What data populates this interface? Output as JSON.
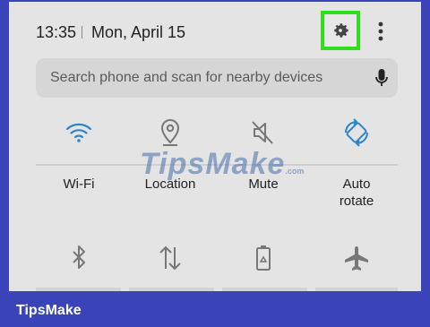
{
  "status": {
    "time": "13:35",
    "date": "Mon, April 15"
  },
  "search": {
    "placeholder": "Search phone and scan for nearby devices"
  },
  "tiles": [
    {
      "label": "Wi-Fi",
      "icon": "wifi-icon",
      "active": true
    },
    {
      "label": "Location",
      "icon": "location-pin-icon",
      "active": false
    },
    {
      "label": "Mute",
      "icon": "mute-icon",
      "active": false
    },
    {
      "label": "Auto\nrotate",
      "icon": "auto-rotate-icon",
      "active": true
    }
  ],
  "tiles_row2": [
    {
      "icon": "bluetooth-icon"
    },
    {
      "icon": "data-transfer-icon"
    },
    {
      "icon": "battery-saver-icon"
    },
    {
      "icon": "airplane-icon"
    }
  ],
  "watermark": {
    "text": "TipsMake",
    "suffix": ".com"
  },
  "brand": {
    "text": "TipsMake"
  },
  "colors": {
    "accent": "#2b86c8",
    "highlight": "#2ee01b",
    "frame": "#3a44b8"
  }
}
